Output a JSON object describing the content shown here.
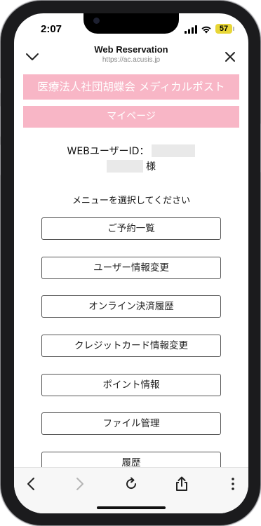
{
  "status_bar": {
    "time": "2:07",
    "battery": "57"
  },
  "browser": {
    "title": "Web Reservation",
    "url": "https://ac.acusis.jp"
  },
  "page": {
    "org_banner": "医療法人社団胡蝶会 メディカルポスト",
    "mypage_label": "マイページ",
    "user_id_label": "WEBユーザーID：",
    "honorific": "様",
    "menu_prompt": "メニューを選択してください",
    "menu_items": [
      "ご予約一覧",
      "ユーザー情報変更",
      "オンライン決済履歴",
      "クレジットカード情報変更",
      "ポイント情報",
      "ファイル管理",
      "履歴"
    ]
  },
  "colors": {
    "banner_pink": "#f8b6c6",
    "battery_yellow": "#e8d637"
  },
  "icons": {
    "collapse": "chevron-down-icon",
    "close": "close-icon",
    "back": "chevron-left-icon",
    "forward": "chevron-right-icon",
    "reload": "reload-icon",
    "share": "share-icon",
    "more": "more-vertical-icon"
  }
}
